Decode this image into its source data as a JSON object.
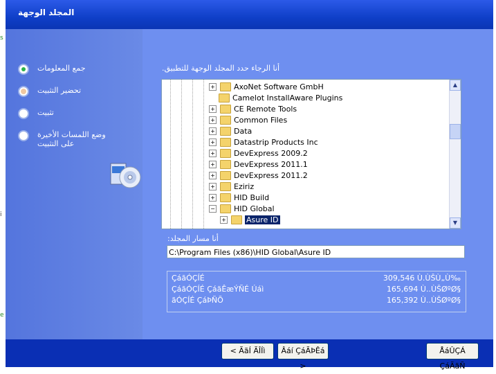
{
  "window": {
    "title": "المجلد الوجهة"
  },
  "steps": [
    {
      "label": "جمع المعلومات",
      "state": "active"
    },
    {
      "label": "تحضير التثبيت",
      "state": "prep"
    },
    {
      "label": "تثبيت",
      "state": "pending"
    },
    {
      "label": "وضع اللمسات الأخيرة على التثبيت",
      "state": "pending"
    }
  ],
  "prompt": "أنا الرجاء حدد المجلد الوجهة للتطبيق.",
  "tree": {
    "items": [
      {
        "label": "AxoNet Software GmbH",
        "expander": "+"
      },
      {
        "label": "Camelot InstallAware Plugins",
        "expander": ""
      },
      {
        "label": "CE Remote Tools",
        "expander": "+"
      },
      {
        "label": "Common Files",
        "expander": "+"
      },
      {
        "label": "Data",
        "expander": "+"
      },
      {
        "label": "Datastrip Products Inc",
        "expander": "+"
      },
      {
        "label": "DevExpress 2009.2",
        "expander": "+"
      },
      {
        "label": "DevExpress 2011.1",
        "expander": "+"
      },
      {
        "label": "DevExpress 2011.2",
        "expander": "+"
      },
      {
        "label": "Eziriz",
        "expander": "+"
      },
      {
        "label": "HID Build",
        "expander": "+"
      },
      {
        "label": "HID Global",
        "expander": "−"
      },
      {
        "label": "Asure ID",
        "expander": "+",
        "selected": true
      }
    ]
  },
  "path": {
    "label": "أنا مسار المجلد:",
    "value": "C:\\Program Files (x86)\\HID Global\\Asure ID"
  },
  "space": [
    {
      "name": "ÇáãÓÇÍÉ",
      "value": "309,546 Ù.ÙŠÙ„Ù‰"
    },
    {
      "name": "ÇáãÓÇÍÉ ÇáãÊæÝÑÉ Úáì",
      "value": "165,694 Ù..ÙŠØºØ§"
    },
    {
      "name": "ãÓÇÍÉ ÇáÞÑÕ",
      "value": "165,392 Ù..ÙŠØºØ§"
    }
  ],
  "buttons": {
    "back": "< ÃãÍ ÃÎÍì",
    "next": "Âáí ÇáÃÞÊá >",
    "cancel": "ÅáÛÇÁ ÇáÃãÑ"
  },
  "colors": {
    "panel": "#6e8ff0",
    "side": "#5a7be0",
    "frame": "#0a2fb4"
  }
}
